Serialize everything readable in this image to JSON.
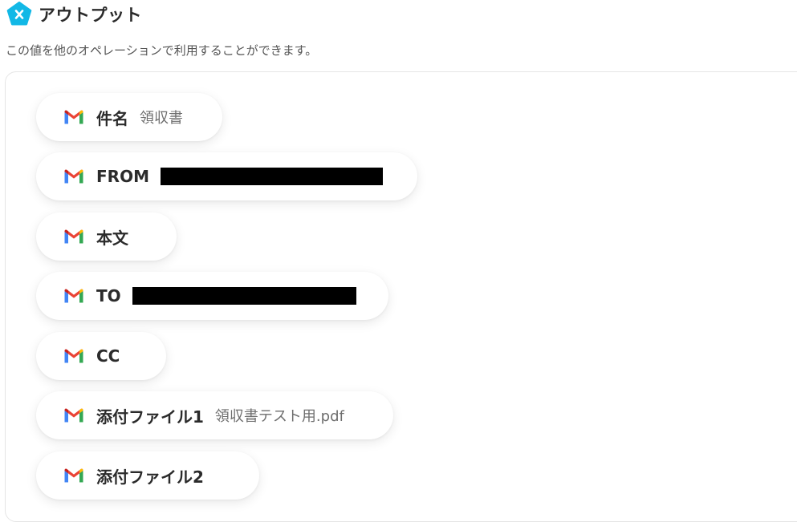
{
  "header": {
    "title": "アウトプット",
    "icon": "x-pentagon-icon",
    "accent": "#12b8e6"
  },
  "description": "この値を他のオペレーションで利用することができます。",
  "outputs": [
    {
      "label": "件名",
      "value": "領収書",
      "icon": "gmail-icon"
    },
    {
      "label": "FROM",
      "value": "",
      "redacted": true,
      "icon": "gmail-icon"
    },
    {
      "label": "本文",
      "value": "",
      "icon": "gmail-icon"
    },
    {
      "label": "TO",
      "value": "",
      "redacted": true,
      "icon": "gmail-icon"
    },
    {
      "label": "CC",
      "value": "",
      "icon": "gmail-icon"
    },
    {
      "label": "添付ファイル1",
      "value": "領収書テスト用.pdf",
      "icon": "gmail-icon"
    },
    {
      "label": "添付ファイル2",
      "value": "",
      "icon": "gmail-icon"
    }
  ]
}
